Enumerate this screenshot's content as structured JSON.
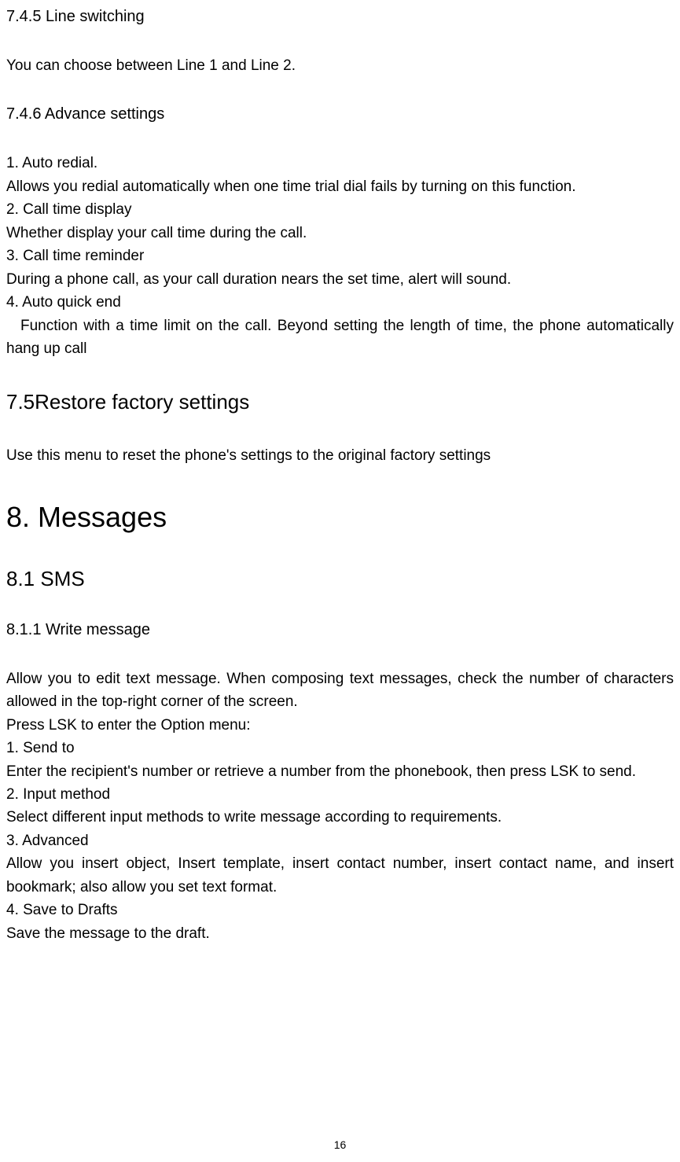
{
  "sections": {
    "s745": {
      "title": "7.4.5 Line switching",
      "p1": "You can choose between Line 1 and Line 2."
    },
    "s746": {
      "title": "7.4.6 Advance settings",
      "i1_title": "1. Auto redial.",
      "i1_body": "Allows you redial automatically when one time trial dial fails by turning on this function.",
      "i2_title": "2. Call time display",
      "i2_body": "Whether display your call time during the call.",
      "i3_title": "3. Call time reminder",
      "i3_body": "During a phone call, as your call duration nears the set time, alert will sound.",
      "i4_title": "4. Auto quick end",
      "i4_body": "Function with a time limit on the call. Beyond setting the length of time, the phone automatically hang up call"
    },
    "s75": {
      "title": "7.5Restore factory settings",
      "p1": "Use this menu to reset the phone's settings to the original factory settings"
    },
    "s8": {
      "title": "8. Messages"
    },
    "s81": {
      "title": "8.1 SMS"
    },
    "s811": {
      "title": "8.1.1 Write message",
      "intro": "Allow you to edit text message. When composing text messages, check the number of characters allowed in the top-right corner of the screen.",
      "press": "Press LSK to enter the Option menu:",
      "i1_title": "1. Send to",
      "i1_body": "Enter the recipient's number or retrieve a number from the phonebook, then press LSK to send.",
      "i2_title": "2. Input method",
      "i2_body": "Select different input methods to write message according to requirements.",
      "i3_title": "3. Advanced",
      "i3_body": "Allow you insert object, Insert template, insert contact number, insert contact name, and insert bookmark; also allow you set text format.",
      "i4_title": "4. Save to Drafts",
      "i4_body": "Save the message to the draft."
    }
  },
  "page_number": "16"
}
